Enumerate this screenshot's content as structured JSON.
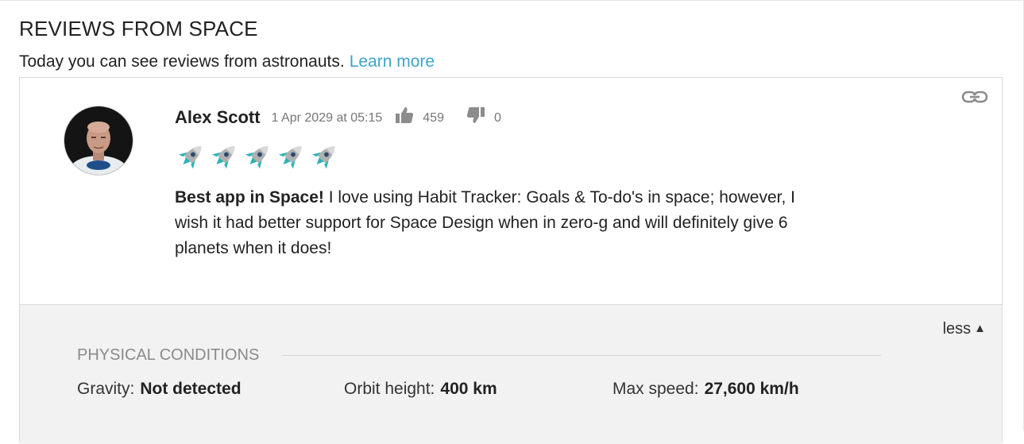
{
  "header": {
    "title": "REVIEWS FROM SPACE",
    "subtitle": "Today you can see reviews from astronauts.",
    "learn_more": "Learn more"
  },
  "review": {
    "author": "Alex Scott",
    "date": "1 Apr 2029 at 05:15",
    "upvotes": "459",
    "downvotes": "0",
    "rating": 5,
    "rating_max": 5,
    "rating_icon": "rocket-icon",
    "headline": "Best app in Space!",
    "body": "I love using Habit Tracker: Goals & To-do's in space; however, I wish it had better support for Space Design when in zero-g and will definitely give 6 planets when it does!"
  },
  "details": {
    "toggle_label": "less",
    "toggle_arrow": "▲",
    "section_title": "PHYSICAL CONDITIONS",
    "stats": [
      {
        "label": "Gravity:",
        "value": "Not detected"
      },
      {
        "label": "Orbit height:",
        "value": "400 km"
      },
      {
        "label": "Max speed:",
        "value": "27,600 km/h"
      }
    ]
  },
  "colors": {
    "link": "#3fa3c7",
    "rocket_body": "#b0b0b0",
    "rocket_fin": "#2ab3b6",
    "details_bg": "#f2f2f2"
  }
}
